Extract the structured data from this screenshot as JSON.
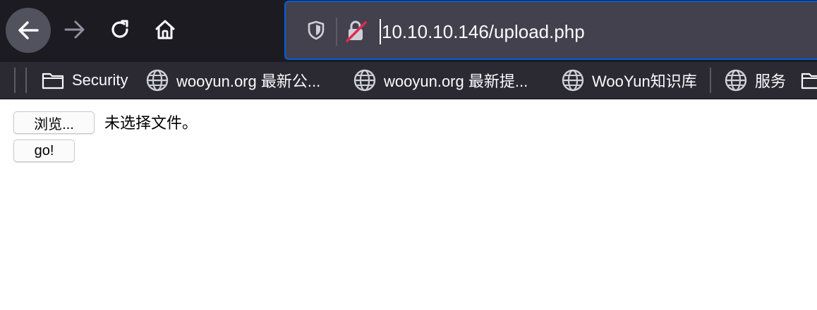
{
  "toolbar": {
    "back_icon": "arrow-left-icon",
    "forward_icon": "arrow-right-icon",
    "reload_icon": "reload-icon",
    "home_icon": "home-icon"
  },
  "urlbar": {
    "url": "10.10.10.146/upload.php",
    "tracking_icon": "shield-icon",
    "insecure_icon": "insecure-lock-icon",
    "focus_color": "#0060df"
  },
  "bookmarks": {
    "items": [
      {
        "label": "Security",
        "icon": "folder-icon"
      },
      {
        "label": "wooyun.org 最新公...",
        "icon": "globe-icon"
      },
      {
        "label": "wooyun.org 最新提...",
        "icon": "globe-icon"
      },
      {
        "label": "WooYun知识库",
        "icon": "globe-icon"
      },
      {
        "label": "服务",
        "icon": "globe-icon"
      },
      {
        "label": "",
        "icon": "folder-icon"
      }
    ]
  },
  "page": {
    "browse_label": "浏览...",
    "file_status": "未选择文件。",
    "submit_label": "go!"
  },
  "colors": {
    "toolbar_bg": "#1c1b22",
    "bookmarks_bg": "#2b2a33",
    "urlbar_bg": "#42414d",
    "text_light": "#fbfbfe"
  }
}
